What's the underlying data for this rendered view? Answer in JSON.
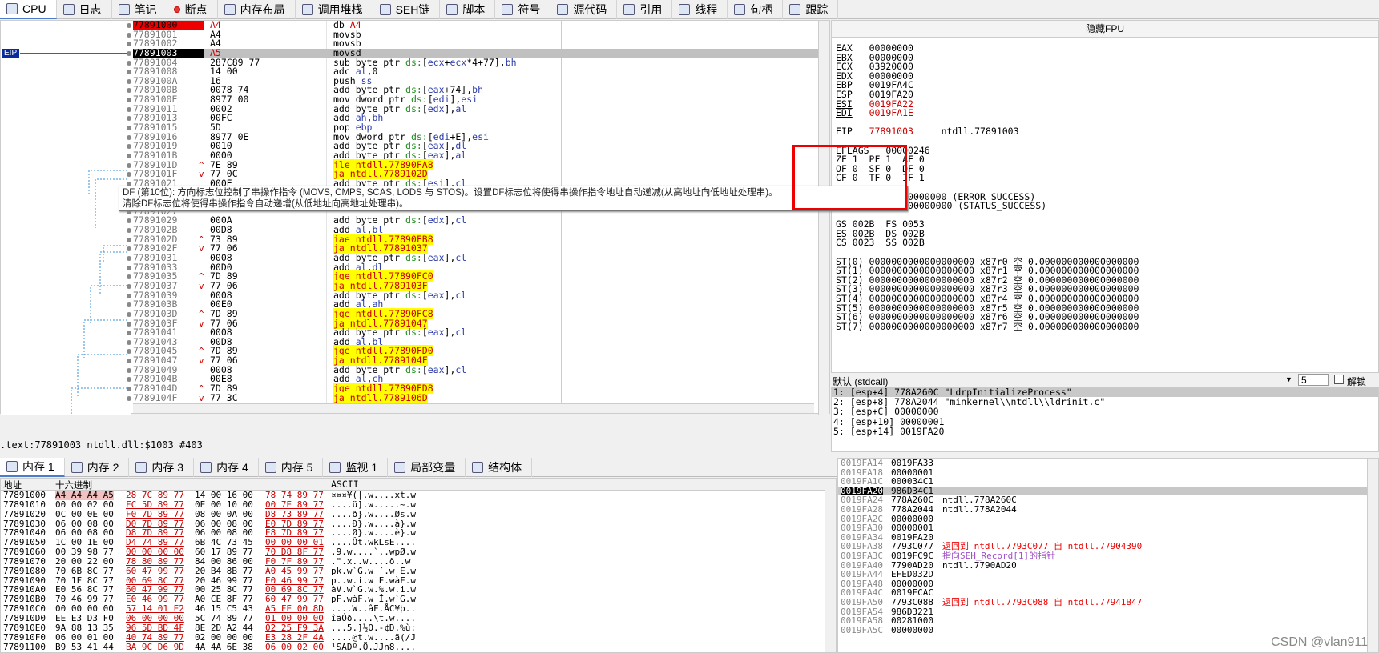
{
  "tabs": [
    {
      "label": "CPU",
      "icon": "cpu-icon"
    },
    {
      "label": "日志",
      "icon": "log-icon"
    },
    {
      "label": "笔记",
      "icon": "notes-icon"
    },
    {
      "label": "断点",
      "icon": "breakpoint-icon"
    },
    {
      "label": "内存布局",
      "icon": "memory-map-icon"
    },
    {
      "label": "调用堆栈",
      "icon": "call-stack-icon"
    },
    {
      "label": "SEH链",
      "icon": "seh-chain-icon"
    },
    {
      "label": "脚本",
      "icon": "script-icon"
    },
    {
      "label": "符号",
      "icon": "symbols-icon"
    },
    {
      "label": "源代码",
      "icon": "source-icon"
    },
    {
      "label": "引用",
      "icon": "references-icon"
    },
    {
      "label": "线程",
      "icon": "threads-icon"
    },
    {
      "label": "句柄",
      "icon": "handles-icon"
    },
    {
      "label": "跟踪",
      "icon": "trace-icon"
    }
  ],
  "eip_label": "EIP",
  "disasm": [
    {
      "addr": "77891000",
      "bytes": "A4",
      "ins": "db A4",
      "style": "red"
    },
    {
      "addr": "77891001",
      "bytes": "A4",
      "ins": "movsb"
    },
    {
      "addr": "77891002",
      "bytes": "A4",
      "ins": "movsb"
    },
    {
      "addr": "77891003",
      "bytes": "A5",
      "ins": "movsd",
      "style": "cur"
    },
    {
      "addr": "77891004",
      "bytes": "287C89 77",
      "ins": "sub byte ptr ds:[ecx+ecx*4+77],bh"
    },
    {
      "addr": "77891008",
      "bytes": "14 00",
      "ins": "adc al,0"
    },
    {
      "addr": "7789100A",
      "bytes": "16",
      "ins": "push ss"
    },
    {
      "addr": "7789100B",
      "bytes": "0078 74",
      "ins": "add byte ptr ds:[eax+74],bh"
    },
    {
      "addr": "7789100E",
      "bytes": "8977 00",
      "ins": "mov dword ptr ds:[edi],esi"
    },
    {
      "addr": "77891011",
      "bytes": "0002",
      "ins": "add byte ptr ds:[edx],al"
    },
    {
      "addr": "77891013",
      "bytes": "00FC",
      "ins": "add ah,bh"
    },
    {
      "addr": "77891015",
      "bytes": "5D",
      "ins": "pop ebp"
    },
    {
      "addr": "77891016",
      "bytes": "8977 0E",
      "ins": "mov dword ptr ds:[edi+E],esi"
    },
    {
      "addr": "77891019",
      "bytes": "0010",
      "ins": "add byte ptr ds:[eax],dl"
    },
    {
      "addr": "7789101B",
      "bytes": "0000",
      "ins": "add byte ptr ds:[eax],al"
    },
    {
      "addr": "7789101D",
      "bytes": "7E 89",
      "ins": "jle ntdll.77890FA8",
      "jmp": "^",
      "style": "jump"
    },
    {
      "addr": "7789101F",
      "bytes": "77 0C",
      "ins": "ja ntdll.7789102D",
      "jmp": "v",
      "style": "jump"
    },
    {
      "addr": "77891021",
      "bytes": "000E",
      "ins": "add byte ptr ds:[esi],cl"
    },
    {
      "addr": "77891023",
      "bytes": "",
      "ins": ""
    },
    {
      "addr": "77891025",
      "bytes": "",
      "ins": ""
    },
    {
      "addr": "77891027",
      "bytes": "",
      "ins": ""
    },
    {
      "addr": "77891029",
      "bytes": "000A",
      "ins": "add byte ptr ds:[edx],cl"
    },
    {
      "addr": "7789102B",
      "bytes": "00D8",
      "ins": "add al,bl"
    },
    {
      "addr": "7789102D",
      "bytes": "73 89",
      "ins": "jae ntdll.77890FB8",
      "jmp": "^",
      "style": "jump"
    },
    {
      "addr": "7789102F",
      "bytes": "77 06",
      "ins": "ja ntdll.77891037",
      "jmp": "v",
      "style": "jump"
    },
    {
      "addr": "77891031",
      "bytes": "0008",
      "ins": "add byte ptr ds:[eax],cl"
    },
    {
      "addr": "77891033",
      "bytes": "00D0",
      "ins": "add al,dl"
    },
    {
      "addr": "77891035",
      "bytes": "7D 89",
      "ins": "jge ntdll.77890FC0",
      "jmp": "^",
      "style": "jump"
    },
    {
      "addr": "77891037",
      "bytes": "77 06",
      "ins": "ja ntdll.7789103F",
      "jmp": "v",
      "style": "jump"
    },
    {
      "addr": "77891039",
      "bytes": "0008",
      "ins": "add byte ptr ds:[eax],cl"
    },
    {
      "addr": "7789103B",
      "bytes": "00E0",
      "ins": "add al,ah"
    },
    {
      "addr": "7789103D",
      "bytes": "7D 89",
      "ins": "jge ntdll.77890FC8",
      "jmp": "^",
      "style": "jump"
    },
    {
      "addr": "7789103F",
      "bytes": "77 06",
      "ins": "ja ntdll.77891047",
      "jmp": "v",
      "style": "jump"
    },
    {
      "addr": "77891041",
      "bytes": "0008",
      "ins": "add byte ptr ds:[eax],cl"
    },
    {
      "addr": "77891043",
      "bytes": "00D8",
      "ins": "add al,bl"
    },
    {
      "addr": "77891045",
      "bytes": "7D 89",
      "ins": "jge ntdll.77890FD0",
      "jmp": "^",
      "style": "jump"
    },
    {
      "addr": "77891047",
      "bytes": "77 06",
      "ins": "ja ntdll.7789104F",
      "jmp": "v",
      "style": "jump"
    },
    {
      "addr": "77891049",
      "bytes": "0008",
      "ins": "add byte ptr ds:[eax],cl"
    },
    {
      "addr": "7789104B",
      "bytes": "00E8",
      "ins": "add al,ch"
    },
    {
      "addr": "7789104D",
      "bytes": "7D 89",
      "ins": "jge ntdll.77890FD8",
      "jmp": "^",
      "style": "jump"
    },
    {
      "addr": "7789104F",
      "bytes": "77 3C",
      "ins": "ja ntdll.7789106D",
      "jmp": "v",
      "style": "jump"
    }
  ],
  "tooltip_lines": [
    "DF (第10位): 方向标志位控制了串操作指令 (MOVS, CMPS, SCAS, LODS 与 STOS)。设置DF标志位将使得串操作指令地址自动递减(从高地址向低地址处理串)。",
    "清除DF标志位将使得串操作指令自动递增(从低地址向高地址处理串)。"
  ],
  "status_line": ".text:77891003 ntdll.dll:$1003 #403",
  "regs_title": "隐藏FPU",
  "regs": [
    {
      "name": "EAX",
      "val": "00000000"
    },
    {
      "name": "EBX",
      "val": "00000000"
    },
    {
      "name": "ECX",
      "val": "03920000"
    },
    {
      "name": "EDX",
      "val": "00000000"
    },
    {
      "name": "EBP",
      "val": "0019FA4C"
    },
    {
      "name": "ESP",
      "val": "0019FA20"
    },
    {
      "name": "ESI",
      "val": "0019FA22",
      "changed": true
    },
    {
      "name": "EDI",
      "val": "0019FA1E",
      "changed": true
    },
    {
      "name": "",
      "val": ""
    },
    {
      "name": "EIP",
      "val": "77891003",
      "extra": "ntdll.77891003",
      "changed": true
    },
    {
      "name": "",
      "val": ""
    },
    {
      "name": "EFLAGS",
      "val": "00000246"
    },
    {
      "name": "ZF 1  PF 1  AF 0",
      "val": ""
    },
    {
      "name": "OF 0  SF 0  DF 0",
      "val": ""
    },
    {
      "name": "CF 0  TF 0  IF 1",
      "val": ""
    },
    {
      "name": "",
      "val": ""
    },
    {
      "name": "LastError",
      "val": "00000000 (ERROR_SUCCESS)"
    },
    {
      "name": "LastStatus",
      "val": "00000000 (STATUS_SUCCESS)"
    },
    {
      "name": "",
      "val": ""
    },
    {
      "name": "GS 002B  FS 0053",
      "val": ""
    },
    {
      "name": "ES 002B  DS 002B",
      "val": ""
    },
    {
      "name": "CS 0023  SS 002B",
      "val": ""
    },
    {
      "name": "",
      "val": ""
    },
    {
      "name": "ST(0) 0000000000000000000 x87r0 空 0.000000000000000000",
      "val": ""
    },
    {
      "name": "ST(1) 0000000000000000000 x87r1 空 0.000000000000000000",
      "val": ""
    },
    {
      "name": "ST(2) 0000000000000000000 x87r2 空 0.000000000000000000",
      "val": ""
    },
    {
      "name": "ST(3) 0000000000000000000 x87r3 空 0.000000000000000000",
      "val": ""
    },
    {
      "name": "ST(4) 0000000000000000000 x87r4 空 0.000000000000000000",
      "val": ""
    },
    {
      "name": "ST(5) 0000000000000000000 x87r5 空 0.000000000000000000",
      "val": ""
    },
    {
      "name": "ST(6) 0000000000000000000 x87r6 空 0.000000000000000000",
      "val": ""
    },
    {
      "name": "ST(7) 0000000000000000000 x87r7 空 0.000000000000000000",
      "val": ""
    }
  ],
  "callconv": {
    "label": "默认 (stdcall)",
    "count": "5",
    "unlock": "解锁"
  },
  "callstack": [
    "1: [esp+4] 778A260C \"LdrpInitializeProcess\"",
    "2: [esp+8] 778A2044 \"minkernel\\\\ntdll\\\\ldrinit.c\"",
    "3: [esp+C] 00000000",
    "4: [esp+10] 00000001",
    "5: [esp+14] 0019FA20"
  ],
  "memtabs": [
    {
      "label": "内存 1",
      "icon": "memory-icon"
    },
    {
      "label": "内存 2",
      "icon": "memory-icon"
    },
    {
      "label": "内存 3",
      "icon": "memory-icon"
    },
    {
      "label": "内存 4",
      "icon": "memory-icon"
    },
    {
      "label": "内存 5",
      "icon": "memory-icon"
    },
    {
      "label": "监视 1",
      "icon": "watch-icon"
    },
    {
      "label": "局部变量",
      "icon": "locals-icon"
    },
    {
      "label": "结构体",
      "icon": "struct-icon"
    }
  ],
  "dump_headers": {
    "addr": "地址",
    "hex": "十六进制",
    "ascii": "ASCII"
  },
  "dump": [
    {
      "addr": "77891000",
      "hex": [
        "A4 A4 A4 A5",
        "28 7C 89 77",
        "14 00 16 00",
        "78 74 89 77"
      ],
      "ascii": "¤¤¤¥(|.w....xt.w"
    },
    {
      "addr": "77891010",
      "hex": [
        "00 00 02 00",
        "FC 5D 89 77",
        "0E 00 10 00",
        "00 7E 89 77"
      ],
      "ascii": "....ü].w.....~.w"
    },
    {
      "addr": "77891020",
      "hex": [
        "0C 00 0E 00",
        "F0 7D 89 77",
        "08 00 0A 00",
        "D8 73 89 77"
      ],
      "ascii": "....ð}.w....Øs.w"
    },
    {
      "addr": "77891030",
      "hex": [
        "06 00 08 00",
        "D0 7D 89 77",
        "06 00 08 00",
        "E0 7D 89 77"
      ],
      "ascii": "....Ð}.w....à}.w"
    },
    {
      "addr": "77891040",
      "hex": [
        "06 00 08 00",
        "D8 7D 89 77",
        "06 00 08 00",
        "E8 7D 89 77"
      ],
      "ascii": "....Ø}.w....è}.w"
    },
    {
      "addr": "77891050",
      "hex": [
        "1C 00 1E 00",
        "D4 74 89 77",
        "6B 4C 73 45",
        "00 00 00 01"
      ],
      "ascii": "....Ôt.wkLsE...."
    },
    {
      "addr": "77891060",
      "hex": [
        "00 39 98 77",
        "00 00 00 00",
        "60 17 89 77",
        "70 D8 8F 77"
      ],
      "ascii": ".9.w....`..wpØ.w"
    },
    {
      "addr": "77891070",
      "hex": [
        "20 00 22 00",
        "78 80 89 77",
        "84 00 86 00",
        "F0 7F 89 77"
      ],
      "ascii": " .\".x..w....ð..w"
    },
    {
      "addr": "77891080",
      "hex": [
        "70 6B 8C 77",
        "60 47 99 77",
        "20 B4 8B 77",
        "A0 45 99 77"
      ],
      "ascii": "pk.w`G.w ´.w E.w"
    },
    {
      "addr": "77891090",
      "hex": [
        "70 1F 8C 77",
        "00 69 8C 77",
        "20 46 99 77",
        "E0 46 99 77"
      ],
      "ascii": "p..w.i.w F.wàF.w"
    },
    {
      "addr": "778910A0",
      "hex": [
        "E0 56 8C 77",
        "60 47 99 77",
        "00 25 8C 77",
        "00 69 8C 77"
      ],
      "ascii": "àV.w`G.w.%.w.i.w"
    },
    {
      "addr": "778910B0",
      "hex": [
        "70 46 99 77",
        "E0 46 99 77",
        "A0 CE 8F 77",
        "60 47 99 77"
      ],
      "ascii": "pF.wàF.w Î.w`G.w"
    },
    {
      "addr": "778910C0",
      "hex": [
        "00 00 00 00",
        "57 14 01 E2",
        "46 15 C5 43",
        "A5 FE 00 8D"
      ],
      "ascii": "....W..âF.ÅC¥þ.."
    },
    {
      "addr": "778910D0",
      "hex": [
        "EE E3 D3 F0",
        "06 00 00 00",
        "5C 74 89 77",
        "01 00 00 00"
      ],
      "ascii": "îãÓð....\\t.w...."
    },
    {
      "addr": "778910E0",
      "hex": [
        "9A 88 13 35",
        "96 5D BD 4F",
        "8E 2D A2 44",
        "02 25 F9 3A"
      ],
      "ascii": "...5.]½O.-¢D.%ù:"
    },
    {
      "addr": "778910F0",
      "hex": [
        "06 00 01 00",
        "40 74 89 77",
        "02 00 00 00",
        "E3 28 2F 4A"
      ],
      "ascii": "....@t.w....ã(/J"
    },
    {
      "addr": "77891100",
      "hex": [
        "B9 53 41 44",
        "BA 9C D6 9D",
        "4A 4A 6E 38",
        "06 00 02 00"
      ],
      "ascii": "¹SADº.Ö.JJn8...."
    }
  ],
  "stack": [
    {
      "addr": "0019FA14",
      "val": "0019FA33",
      "cmt": ""
    },
    {
      "addr": "0019FA18",
      "val": "00000001",
      "cmt": ""
    },
    {
      "addr": "0019FA1C",
      "val": "000034C1",
      "cmt": ""
    },
    {
      "addr": "0019FA20",
      "val": "986D34C1",
      "cmt": "",
      "sel": true
    },
    {
      "addr": "0019FA24",
      "val": "778A260C",
      "cmt": "ntdll.778A260C"
    },
    {
      "addr": "0019FA28",
      "val": "778A2044",
      "cmt": "ntdll.778A2044"
    },
    {
      "addr": "0019FA2C",
      "val": "00000000",
      "cmt": ""
    },
    {
      "addr": "0019FA30",
      "val": "00000001",
      "cmt": ""
    },
    {
      "addr": "0019FA34",
      "val": "0019FA20",
      "cmt": ""
    },
    {
      "addr": "0019FA38",
      "val": "7793C077",
      "cmt": "返回到 ntdll.7793C077 自 ntdll.77904390",
      "red": true
    },
    {
      "addr": "0019FA3C",
      "val": "0019FC9C",
      "cmt": "指向SEH_Record[1]的指针",
      "purple": true
    },
    {
      "addr": "0019FA40",
      "val": "7790AD20",
      "cmt": "ntdll.7790AD20"
    },
    {
      "addr": "0019FA44",
      "val": "EFED032D",
      "cmt": ""
    },
    {
      "addr": "0019FA48",
      "val": "00000000",
      "cmt": ""
    },
    {
      "addr": "0019FA4C",
      "val": "0019FCAC",
      "cmt": ""
    },
    {
      "addr": "0019FA50",
      "val": "7793C088",
      "cmt": "返回到 ntdll.7793C088 自 ntdll.77941B47",
      "red": true
    },
    {
      "addr": "0019FA54",
      "val": "986D3221",
      "cmt": ""
    },
    {
      "addr": "0019FA58",
      "val": "00281000",
      "cmt": ""
    },
    {
      "addr": "0019FA5C",
      "val": "00000000",
      "cmt": ""
    }
  ],
  "watermark": "CSDN @vlan911"
}
